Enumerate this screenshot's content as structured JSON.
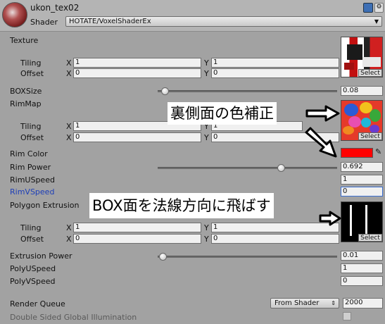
{
  "header": {
    "material_name": "ukon_tex02",
    "shader_label": "Shader",
    "shader_value": "HOTATE/VoxelShaderEx"
  },
  "texture": {
    "label": "Texture",
    "tiling_label": "Tiling",
    "offset_label": "Offset",
    "tiling_x": "1",
    "tiling_y": "1",
    "offset_x": "0",
    "offset_y": "0",
    "select_label": "Select"
  },
  "boxsize": {
    "label": "BOXSize",
    "value": "0.08",
    "level": 0.02
  },
  "rimmap": {
    "label": "RimMap",
    "tiling_label": "Tiling",
    "offset_label": "Offset",
    "tiling_x": "1",
    "tiling_y": "1",
    "offset_x": "0",
    "offset_y": "0",
    "select_label": "Select"
  },
  "rim_color": {
    "label": "Rim Color",
    "color": "#ff0000"
  },
  "rim_power": {
    "label": "Rim Power",
    "value": "0.692",
    "level": 0.692
  },
  "rim_u_speed": {
    "label": "RimUSpeed",
    "value": "1"
  },
  "rim_v_speed": {
    "label": "RimVSpeed",
    "value": "0"
  },
  "polygon_extrusion": {
    "label": "Polygon Extrusion",
    "tiling_label": "Tiling",
    "offset_label": "Offset",
    "tiling_x": "1",
    "tiling_y": "1",
    "offset_x": "0",
    "offset_y": "0",
    "select_label": "Select"
  },
  "extrusion_power": {
    "label": "Extrusion Power",
    "value": "0.01",
    "level": 0.01
  },
  "poly_u_speed": {
    "label": "PolyUSpeed",
    "value": "1"
  },
  "poly_v_speed": {
    "label": "PolyVSpeed",
    "value": "0"
  },
  "render_queue": {
    "label": "Render Queue",
    "dropdown": "From Shader",
    "value": "2000"
  },
  "double_sided": {
    "label": "Double Sided Global Illumination"
  },
  "axis": {
    "x": "X",
    "y": "Y"
  },
  "annotations": {
    "rim_callout": "裏側面の色補正",
    "box_callout": "BOX面を法線方向に飛ばす"
  }
}
